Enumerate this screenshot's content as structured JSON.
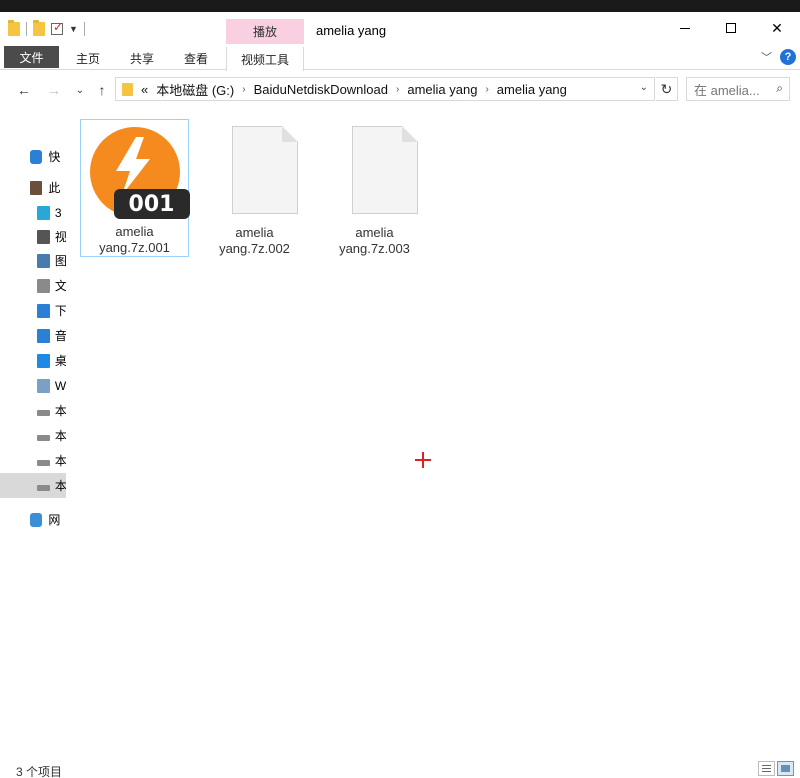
{
  "window": {
    "title": "amelia yang"
  },
  "ribbon": {
    "context_group": "播放",
    "tabs": [
      "文件",
      "主页",
      "共享",
      "查看",
      "视频工具"
    ],
    "help_label": "?"
  },
  "address": {
    "prefix": "«",
    "breadcrumbs": [
      "本地磁盘 (G:)",
      "BaiduNetdiskDownload",
      "amelia yang",
      "amelia yang"
    ]
  },
  "search": {
    "placeholder": "在 amelia..."
  },
  "sidebar": {
    "items": [
      {
        "label": "快",
        "icon": "star-icon",
        "indent": "top"
      },
      {
        "label": "此",
        "icon": "user-pc-icon",
        "indent": "top"
      },
      {
        "label": "3",
        "icon": "3d-objects-icon",
        "indent": "sub"
      },
      {
        "label": "视",
        "icon": "video-icon",
        "indent": "sub"
      },
      {
        "label": "图",
        "icon": "pictures-icon",
        "indent": "sub"
      },
      {
        "label": "文",
        "icon": "documents-icon",
        "indent": "sub"
      },
      {
        "label": "下",
        "icon": "downloads-icon",
        "indent": "sub"
      },
      {
        "label": "音",
        "icon": "music-icon",
        "indent": "sub"
      },
      {
        "label": "桌",
        "icon": "desktop-icon",
        "indent": "sub"
      },
      {
        "label": "W",
        "icon": "windows-drive-icon",
        "indent": "sub"
      },
      {
        "label": "本",
        "icon": "drive-icon",
        "indent": "sub"
      },
      {
        "label": "本",
        "icon": "drive-icon",
        "indent": "sub"
      },
      {
        "label": "本",
        "icon": "drive-icon",
        "indent": "sub"
      },
      {
        "label": "本",
        "icon": "drive-icon",
        "indent": "sub",
        "selected": true
      },
      {
        "label": "网",
        "icon": "network-icon",
        "indent": "top"
      }
    ]
  },
  "files": [
    {
      "name_line1": "amelia",
      "name_line2": "yang.7z.001",
      "type": "archive",
      "badge": "001",
      "selected": true
    },
    {
      "name_line1": "amelia",
      "name_line2": "yang.7z.002",
      "type": "generic"
    },
    {
      "name_line1": "amelia",
      "name_line2": "yang.7z.003",
      "type": "generic"
    }
  ],
  "status": {
    "count": "3 个项目"
  },
  "colors": {
    "accent": "#1e73d8",
    "archive_orange": "#f58b1f",
    "context_tab": "#f9d0e2",
    "selection_border": "#99d1ff"
  }
}
